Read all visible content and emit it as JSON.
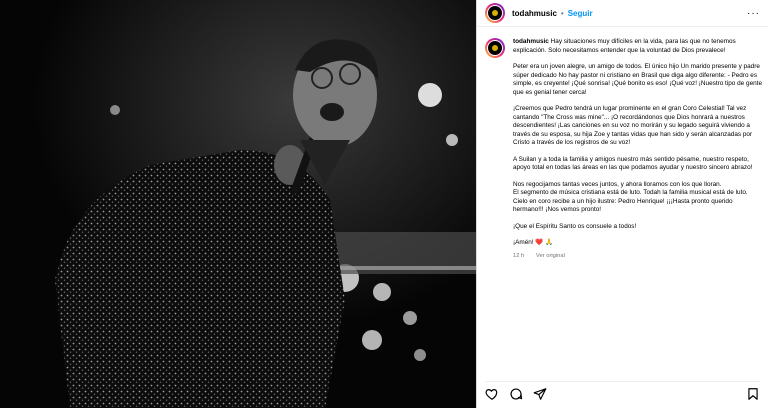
{
  "header": {
    "username": "todahmusic",
    "separator": "•",
    "follow_label": "Seguir",
    "more_label": "···"
  },
  "caption": {
    "username": "todahmusic",
    "paragraphs": [
      "Hay situaciones muy difíciles en la vida, para las que no tenemos explicación. Solo necesitamos entender que la voluntad de Dios prevalece!",
      "Peter era un joven alegre, un amigo de todos. El único hijo Un marido presente y padre súper dedicado No hay pastor ni cristiano en Brasil que diga algo diferente: - Pedro es simple, es creyente! ¡Qué sonrisa! ¡Qué bonito es eso! ¡Qué voz! ¡Nuestro tipo de gente que es genial tener cerca!",
      "¡Creemos que Pedro tendrá un lugar prominente en el gran Coro Celestial! Tal vez cantando \"The Cross was mine\"... ¡O recordándonos que Dios honrará a nuestros descendientes! ¡Las canciones en su voz no morirán y su legado seguirá viviendo a través de su esposa, su hija Zoe y tantas vidas que han sido y serán alcanzadas por Cristo a través de los registros de su voz!",
      "A Suilan y a toda la familia y amigos nuestro más sentido pésame, nuestro respeto, apoyo total en todas las áreas en las que podamos ayudar y nuestro sincero abrazo!",
      "Nos regocijamos tantas veces juntos, y ahora lloramos con los que lloran.\nEl segmento de música cristiana está de luto. Todah la familia musical está de luto. Cielo en coro recibe a un hijo ilustre: Pedro Henrique! ¡¡¡Hasta pronto querido hermano!!! ¡Nos vemos pronto!",
      "¡Que el Espíritu Santo os consuele a todos!"
    ],
    "last_line_text": "¡Amén!",
    "last_line_emoji": "❤️ 🙏"
  },
  "meta": {
    "time": "12 h",
    "see_original": "Ver original"
  },
  "colors": {
    "accent": "#0095f6",
    "heart": "#d1112b"
  },
  "icons": [
    "heart-icon",
    "comment-icon",
    "share-icon",
    "bookmark-icon",
    "more-icon"
  ]
}
